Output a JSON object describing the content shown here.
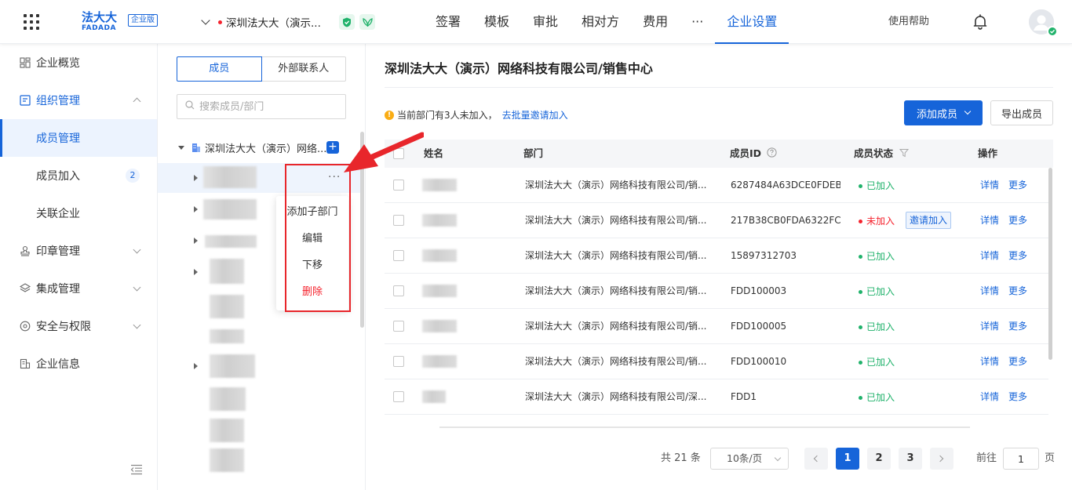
{
  "brand": {
    "logo_text": "法大大",
    "logo_sub": "FADADA",
    "edition": "企业版"
  },
  "company_selector": {
    "name": "深圳法大大（演示..."
  },
  "nav": {
    "items": [
      "签署",
      "模板",
      "审批",
      "相对方",
      "费用",
      "···",
      "企业设置"
    ],
    "active_index": 6
  },
  "header": {
    "help": "使用帮助"
  },
  "sidebar": {
    "items": [
      {
        "label": "企业概览"
      },
      {
        "label": "组织管理"
      },
      {
        "label": "成员管理"
      },
      {
        "label": "成员加入",
        "count": "2"
      },
      {
        "label": "关联企业"
      },
      {
        "label": "印章管理"
      },
      {
        "label": "集成管理"
      },
      {
        "label": "安全与权限"
      },
      {
        "label": "企业信息"
      }
    ]
  },
  "tree": {
    "tabs": [
      "成员",
      "外部联系人"
    ],
    "search_placeholder": "搜索成员/部门",
    "root_name": "深圳法大大（演示）网络...",
    "add_label": "+",
    "more_label": "···",
    "context_menu": [
      "添加子部门",
      "编辑",
      "下移",
      "删除"
    ]
  },
  "main": {
    "title": "深圳法大大（演示）网络科技有限公司/销售中心",
    "notice_text": "当前部门有3人未加入，",
    "notice_link": "去批量邀请加入",
    "add_member": "添加成员",
    "export": "导出成员"
  },
  "table": {
    "columns": [
      "姓名",
      "部门",
      "成员ID",
      "成员状态",
      "操作"
    ],
    "rows": [
      {
        "dept": "深圳法大大（演示）网络科技有限公司/销...",
        "id": "6287484A63DCE0FDEB...",
        "status": "已加入",
        "joined": true
      },
      {
        "dept": "深圳法大大（演示）网络科技有限公司/销...",
        "id": "217B38CB0FDA6322FC...",
        "status": "未加入",
        "joined": false,
        "invite": "邀请加入"
      },
      {
        "dept": "深圳法大大（演示）网络科技有限公司/销...",
        "id": "15897312703",
        "status": "已加入",
        "joined": true
      },
      {
        "dept": "深圳法大大（演示）网络科技有限公司/销...",
        "id": "FDD100003",
        "status": "已加入",
        "joined": true
      },
      {
        "dept": "深圳法大大（演示）网络科技有限公司/销...",
        "id": "FDD100005",
        "status": "已加入",
        "joined": true
      },
      {
        "dept": "深圳法大大（演示）网络科技有限公司/销...",
        "id": "FDD100010",
        "status": "已加入",
        "joined": true
      },
      {
        "dept": "深圳法大大（演示）网络科技有限公司/深...",
        "id": "FDD1",
        "status": "已加入",
        "joined": true
      }
    ],
    "action_detail": "详情",
    "action_more": "更多"
  },
  "pagination": {
    "total": "共 21 条",
    "page_size": "10条/页",
    "pages": [
      "1",
      "2",
      "3"
    ],
    "current": "1",
    "goto_label": "前往",
    "goto_value": "1",
    "page_suffix": "页"
  },
  "colors": {
    "primary": "#1664d9",
    "success": "#20b26b",
    "danger": "#f5222d",
    "warning": "#faad14",
    "annotation": "#e8262b"
  }
}
